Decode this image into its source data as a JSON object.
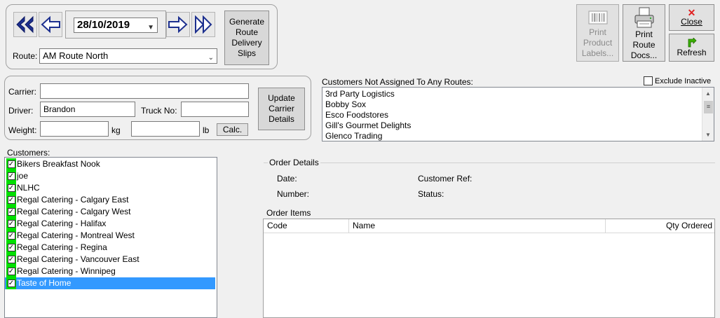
{
  "route_panel": {
    "date": "28/10/2019",
    "route_label": "Route:",
    "route_value": "AM Route North",
    "generate_button": "Generate Route Delivery Slips"
  },
  "toolbar": {
    "print_labels": "Print Product Labels...",
    "print_route_docs": "Print Route Docs...",
    "close": "Close",
    "refresh": "Refresh"
  },
  "carrier_panel": {
    "carrier_label": "Carrier:",
    "carrier_value": "",
    "driver_label": "Driver:",
    "driver_value": "Brandon",
    "truck_label": "Truck No:",
    "truck_value": "",
    "weight_label": "Weight:",
    "weight_kg_value": "",
    "kg_unit": "kg",
    "weight_lb_value": "",
    "lb_unit": "lb",
    "calc_button": "Calc.",
    "update_button": "Update Carrier Details"
  },
  "unassigned": {
    "title": "Customers Not Assigned To Any Routes:",
    "exclude_inactive": "Exclude Inactive",
    "items": [
      "3rd Party Logistics",
      "Bobby Sox",
      "Esco Foodstores",
      "Gill's Gourmet Delights",
      "Glenco Trading"
    ]
  },
  "customers": {
    "title": "Customers:",
    "items": [
      "Bikers Breakfast Nook",
      "joe",
      "NLHC",
      "Regal Catering - Calgary East",
      "Regal Catering - Calgary West",
      "Regal Catering - Halifax",
      "Regal Catering - Montreal West",
      "Regal Catering - Regina",
      "Regal Catering - Vancouver East",
      "Regal Catering - Winnipeg",
      "Taste of Home"
    ]
  },
  "order_details": {
    "title": "Order Details",
    "date_label": "Date:",
    "number_label": "Number:",
    "customer_ref_label": "Customer Ref:",
    "status_label": "Status:"
  },
  "order_items": {
    "title": "Order Items",
    "columns": [
      "Code",
      "Name",
      "Qty Ordered"
    ]
  },
  "colors": {
    "nav_arrow": "#1c2f8f",
    "check_highlight": "#00e000",
    "selection": "#3399ff",
    "close_x": "#e02020",
    "refresh_arrow": "#3bb000"
  }
}
